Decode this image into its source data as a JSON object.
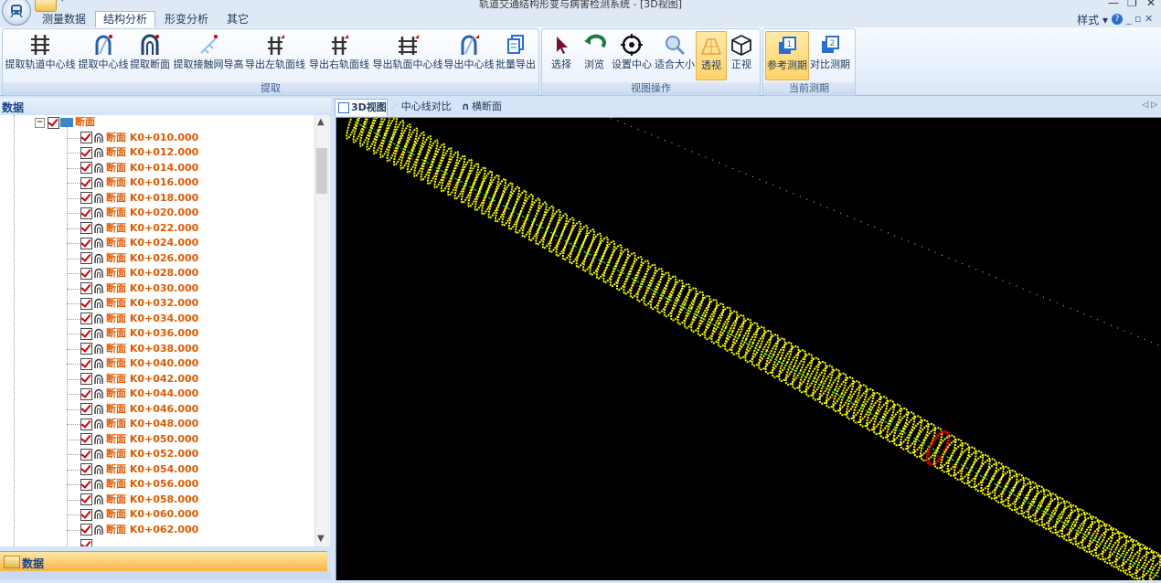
{
  "window": {
    "title": "轨道交通结构形变与病害检测系统 - [3D视图]",
    "minimize": "—",
    "restore": "❐",
    "close": "✕"
  },
  "ribbon": {
    "tabs": [
      {
        "label": "测量数据",
        "active": false
      },
      {
        "label": "结构分析",
        "active": true
      },
      {
        "label": "形变分析",
        "active": false
      },
      {
        "label": "其它",
        "active": false
      }
    ],
    "style_menu": "样式 ▾",
    "help": "?",
    "mini_controls": "_ ▫ ✕",
    "groups": [
      {
        "label": "提取",
        "buttons": [
          "提取轨道中心线",
          "提取中心线",
          "提取断面",
          "提取接触网导高",
          "导出左轨面线",
          "导出右轨面线",
          "导出轨面中心线",
          "导出中心线",
          "批量导出"
        ]
      },
      {
        "label": "视图操作",
        "buttons": [
          "选择",
          "浏览",
          "设置中心",
          "适合大小",
          "透视",
          "正视"
        ]
      },
      {
        "label": "当前测期",
        "buttons": [
          "参考测期",
          "对比测期"
        ]
      }
    ]
  },
  "left_panel": {
    "header": "数据",
    "root_label": "断面",
    "items": [
      "断面 K0+010.000",
      "断面 K0+012.000",
      "断面 K0+014.000",
      "断面 K0+016.000",
      "断面 K0+018.000",
      "断面 K0+020.000",
      "断面 K0+022.000",
      "断面 K0+024.000",
      "断面 K0+026.000",
      "断面 K0+028.000",
      "断面 K0+030.000",
      "断面 K0+032.000",
      "断面 K0+034.000",
      "断面 K0+036.000",
      "断面 K0+038.000",
      "断面 K0+040.000",
      "断面 K0+042.000",
      "断面 K0+044.000",
      "断面 K0+046.000",
      "断面 K0+048.000",
      "断面 K0+050.000",
      "断面 K0+052.000",
      "断面 K0+054.000",
      "断面 K0+056.000",
      "断面 K0+058.000",
      "断面 K0+060.000",
      "断面 K0+062.000"
    ],
    "bottom_tab": "数据"
  },
  "view_tabs": [
    {
      "label": "3D视图",
      "active": true
    },
    {
      "label": "中心线对比",
      "active": false
    },
    {
      "label": "横断面",
      "active": false
    }
  ],
  "view_nav": "◁ ▷",
  "colors": {
    "rings": "#ffff00",
    "highlight_ring": "#ff0000",
    "centerline": "#00ff66",
    "tree_text": "#e05a00",
    "viewport_bg": "#000000"
  }
}
